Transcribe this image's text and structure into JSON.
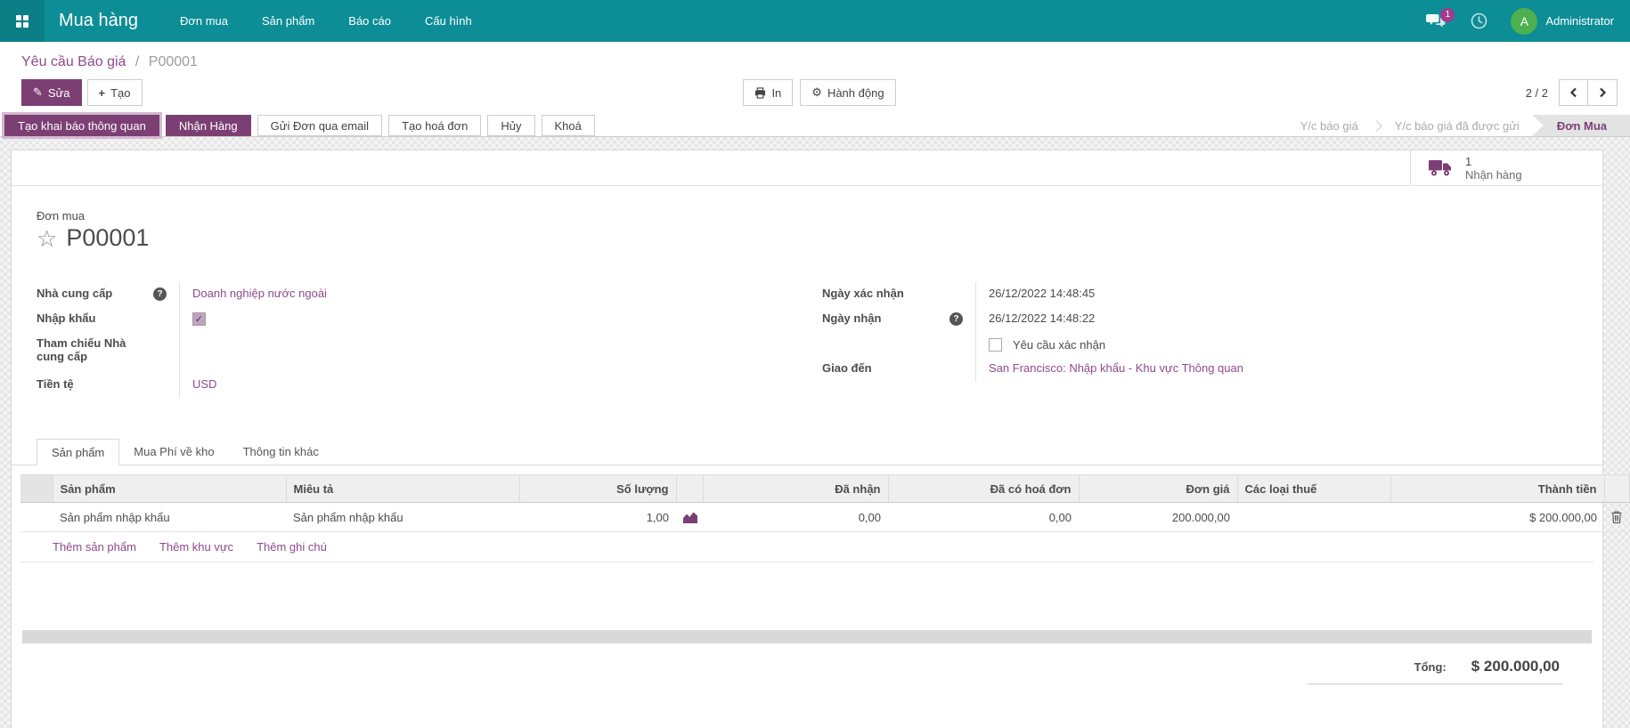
{
  "navbar": {
    "app_name": "Mua hàng",
    "menu": [
      "Đơn mua",
      "Sản phẩm",
      "Báo cáo",
      "Cấu hình"
    ],
    "messages_badge": "1",
    "user_name": "Administrator",
    "avatar_initial": "A"
  },
  "breadcrumb": {
    "parent": "Yêu cầu Báo giá",
    "separator": "/",
    "current": "P00001"
  },
  "control_panel": {
    "edit_label": "Sửa",
    "create_label": "Tạo",
    "print_label": "In",
    "action_label": "Hành động",
    "pager": "2 / 2"
  },
  "statusbar": {
    "buttons": [
      "Tạo khai báo thông quan",
      "Nhận Hàng",
      "Gửi Đơn qua email",
      "Tạo hoá đơn",
      "Hủy",
      "Khoá"
    ],
    "states": [
      "Y/c báo giá",
      "Y/c báo giá đã được gửi",
      "Đơn Mua"
    ],
    "active_state": "Đơn Mua"
  },
  "smart_button": {
    "count": "1",
    "label": "Nhận hàng"
  },
  "form": {
    "doc_type_label": "Đơn mua",
    "name": "P00001",
    "supplier": {
      "label": "Nhà cung cấp",
      "value": "Doanh nghiệp nước ngoài"
    },
    "import": {
      "label": "Nhập khẩu",
      "checked": true
    },
    "vendor_ref": {
      "label": "Tham chiếu Nhà cung cấp",
      "value": ""
    },
    "currency": {
      "label": "Tiền tệ",
      "value": "USD"
    },
    "confirm_date": {
      "label": "Ngày xác nhận",
      "value": "26/12/2022 14:48:45"
    },
    "receipt_date": {
      "label": "Ngày nhận",
      "value": "26/12/2022 14:48:22"
    },
    "ask_confirm": {
      "label": "Yêu cầu xác nhận",
      "checked": false
    },
    "deliver_to": {
      "label": "Giao đến",
      "value": "San Francisco: Nhập khẩu - Khu vực Thông quan"
    }
  },
  "tabs": [
    "Sản phẩm",
    "Mua Phí về kho",
    "Thông tin khác"
  ],
  "table": {
    "headers": [
      "Sản phẩm",
      "Miêu tả",
      "Số lượng",
      "Đã nhận",
      "Đã có hoá đơn",
      "Đơn giá",
      "Các loại thuế",
      "Thành tiền"
    ],
    "row": {
      "product": "Sản phẩm nhập khẩu",
      "description": "Sản phẩm nhập khẩu",
      "quantity": "1,00",
      "received": "0,00",
      "billed": "0,00",
      "unit_price": "200.000,00",
      "taxes": "",
      "subtotal": "$ 200.000,00"
    },
    "links": [
      "Thêm sản phẩm",
      "Thêm khu vực",
      "Thêm ghi chú"
    ]
  },
  "totals": {
    "label": "Tổng:",
    "amount": "$ 200.000,00"
  },
  "colors": {
    "navbar": "#0d8d96",
    "primary": "#7c3f74",
    "link": "#8f4a8b",
    "avatar": "#4caf50",
    "badge": "#a23b8f"
  }
}
